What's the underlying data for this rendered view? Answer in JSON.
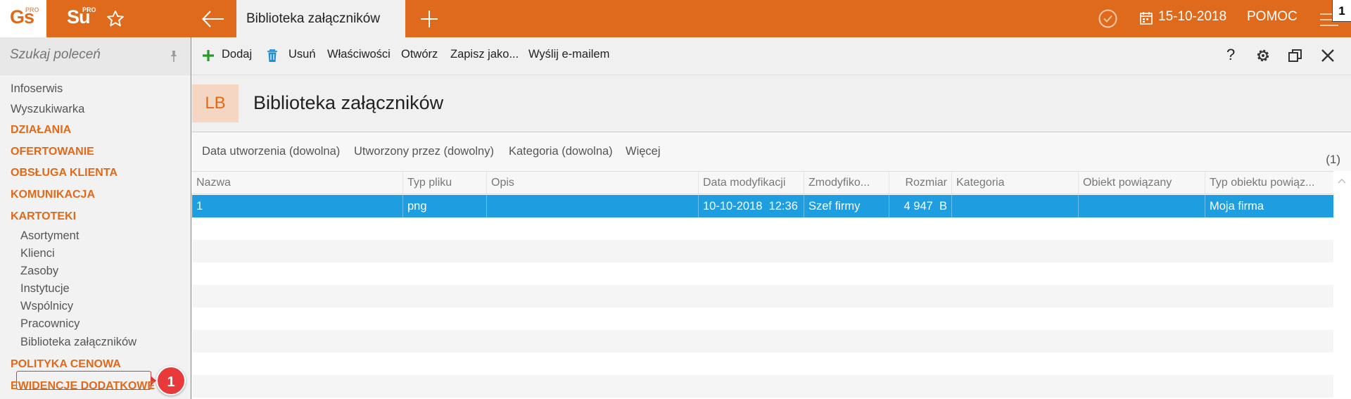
{
  "topbar": {
    "logo_gs": "Gs",
    "logo_gs_sup": "PRO",
    "logo_su": "Su",
    "logo_su_sup": "PRO",
    "active_tab": "Biblioteka załączników",
    "date": "15-10-2018",
    "help": "POMOC",
    "corner_badge": "1",
    "accent_color": "#e06a1b"
  },
  "sidebar": {
    "search_placeholder": "Szukaj poleceń",
    "items": [
      "Infoserwis",
      "Wyszukiwarka"
    ],
    "sections": [
      "DZIAŁANIA",
      "OFERTOWANIE",
      "OBSŁUGA KLIENTA",
      "KOMUNIKACJA",
      "KARTOTEKI"
    ],
    "kartoteki_items": [
      "Asortyment",
      "Klienci",
      "Zasoby",
      "Instytucje",
      "Wspólnicy",
      "Pracownicy",
      "Biblioteka załączników"
    ],
    "sections_after": [
      "POLITYKA CENOWA",
      "EWIDENCJE DODATKOWE"
    ],
    "callout_number": "1",
    "callout_color": "#e83a3a"
  },
  "toolbar": {
    "add": "Dodaj",
    "delete": "Usuń",
    "properties": "Właściwości",
    "open": "Otwórz",
    "save_as": "Zapisz jako...",
    "send_email": "Wyślij e-mailem",
    "help": "?"
  },
  "header": {
    "badge": "LB",
    "title": "Biblioteka załączników"
  },
  "filters": {
    "items": [
      "Data utworzenia (dowolna)",
      "Utworzony przez (dowolny)",
      "Kategoria (dowolna)",
      "Więcej"
    ],
    "count": "(1)"
  },
  "table": {
    "columns": [
      "Nazwa",
      "Typ pliku",
      "Opis",
      "Data modyfikacji",
      "Zmodyfiko...",
      "Rozmiar",
      "Kategoria",
      "Obiekt powiązany",
      "Typ obiektu powiąz..."
    ],
    "rows": [
      {
        "nazwa": "1",
        "typ": "png",
        "opis": "",
        "data": "10-10-2018",
        "czas": "12:36",
        "zmodyfikowal": "Szef firmy",
        "rozmiar": "4 947",
        "jednostka": "B",
        "kategoria": "",
        "obiekt": "",
        "typ_obiektu": "Moja firma"
      }
    ],
    "selected_color": "#1e9de0"
  }
}
